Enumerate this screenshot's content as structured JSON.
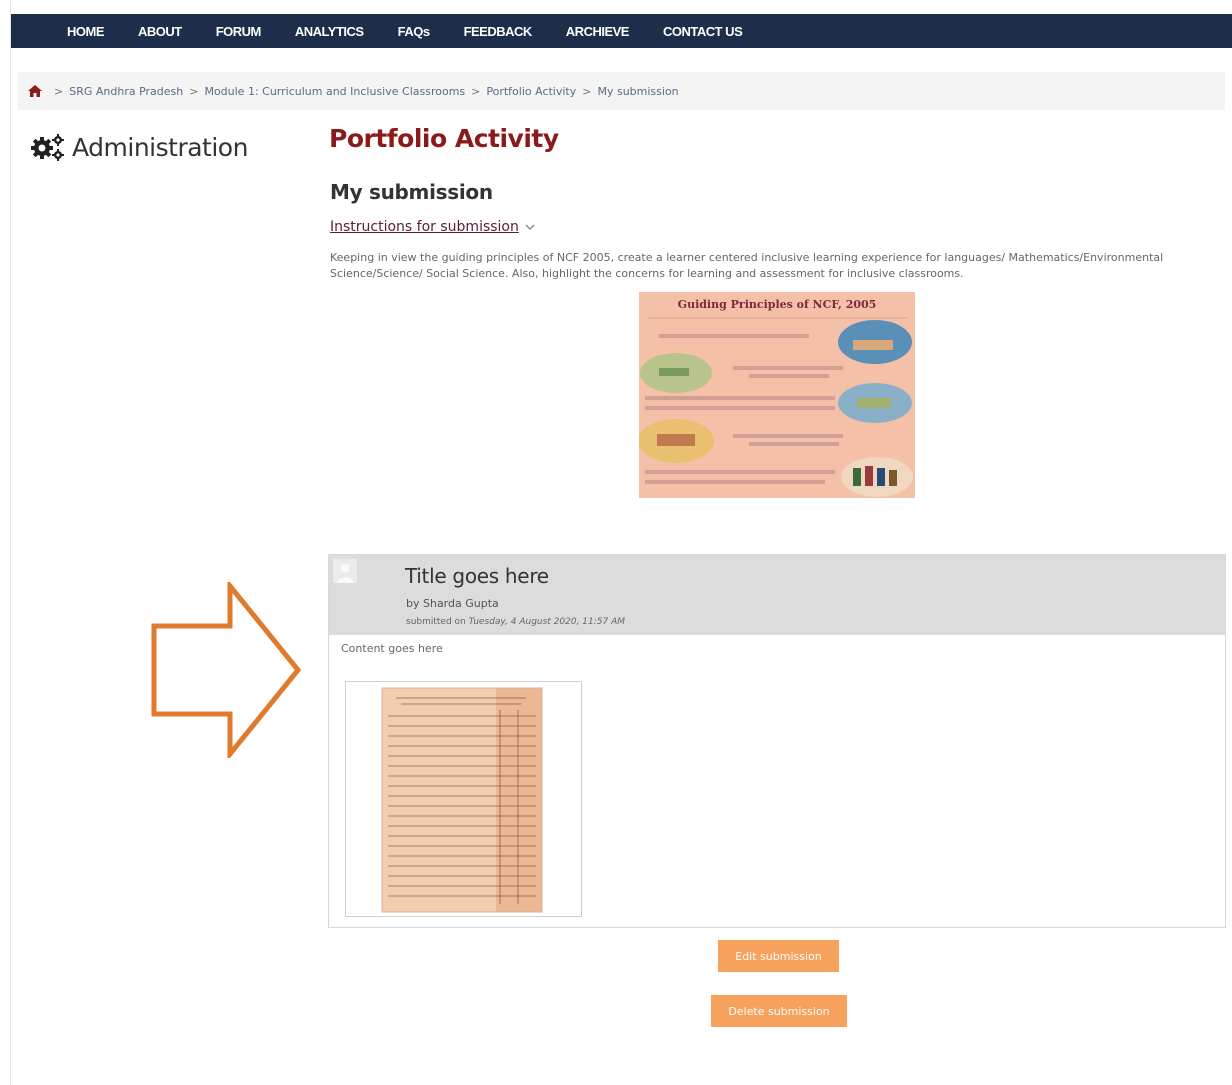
{
  "nav": {
    "items": [
      "HOME",
      "ABOUT",
      "FORUM",
      "ANALYTICS",
      "FAQs",
      "FEEDBACK",
      "ARCHIEVE",
      "CONTACT US"
    ]
  },
  "breadcrumb": {
    "items": [
      "SRG Andhra Pradesh",
      "Module 1: Curriculum and Inclusive Classrooms",
      "Portfolio Activity",
      "My submission"
    ],
    "separator": ">"
  },
  "sidebar": {
    "title": "Administration"
  },
  "main": {
    "page_title": "Portfolio Activity",
    "subheading": "My submission",
    "instructions_label": "Instructions for submission",
    "instructions_text": "Keeping in view the guiding principles of NCF 2005, create a learner centered inclusive learning experience for languages/ Mathematics/Environmental Science/Science/ Social Science. Also,  highlight the concerns for learning and assessment for inclusive classrooms.",
    "poster_title": "Guiding Principles of NCF, 2005"
  },
  "submission": {
    "title": "Title goes here",
    "author": "by Sharda Gupta",
    "submitted_prefix": "submitted on",
    "submitted_date": "Tuesday, 4 August 2020, 11:57 AM",
    "content": "Content goes here"
  },
  "buttons": {
    "edit": "Edit submission",
    "delete": "Delete submission"
  },
  "colors": {
    "nav_bg": "#1c2e4a",
    "title_red": "#8b1b1b",
    "button_orange": "#f6a15c",
    "arrow_orange": "#e07b2e"
  }
}
